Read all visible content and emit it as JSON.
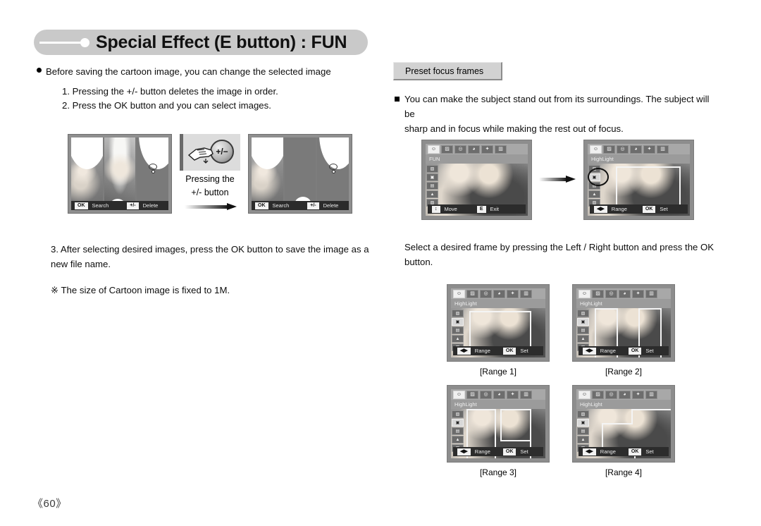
{
  "page": {
    "title": "Special Effect (E button) :  FUN",
    "number": "《60》"
  },
  "left_column": {
    "bullet_1": "Before saving the cartoon image, you can change the selected image",
    "step_1": "1. Pressing the +/- button deletes the image in order.",
    "step_2": "2. Press the OK button and you can select images.",
    "step_3": "3. After selecting desired images, press the OK button to save the image as a\n    new file name.",
    "note": "※ The size of Cartoon image is fixed to 1M.",
    "press_caption_line1": "Pressing the",
    "press_caption_line2": "+/- button",
    "pm_button_label": "+/−",
    "filmstrip_left": {
      "key_ok": "OK",
      "label_search": "Search",
      "key_pm": "+/-",
      "label_delete": "Delete"
    },
    "filmstrip_right": {
      "key_ok": "OK",
      "label_search": "Search",
      "key_pm": "+/-",
      "label_delete": "Delete"
    }
  },
  "right_column": {
    "section_tab": "Preset focus frames",
    "bullet_1": "You can make the subject stand out from its surroundings. The subject will be\nsharp and in focus while making the rest out of focus.",
    "instruction": "Select a desired frame by pressing the Left / Right button and press the OK\nbutton.",
    "icons_top_bar": [
      "face-icon",
      "picture-icon",
      "camera-icon",
      "palette-icon",
      "magic-wand-icon",
      "equalizer-icon"
    ],
    "side_icons": [
      "image-icon",
      "highlight-icon",
      "composite-icon",
      "mountain-icon",
      "frame-icon"
    ],
    "cameras": [
      {
        "mode": "FUN",
        "bottom_key_1": "↕",
        "bottom_label_1": "Move",
        "bottom_key_2": "E",
        "bottom_label_2": "Exit"
      },
      {
        "mode": "HighLight",
        "bottom_key_1": "◀▶",
        "bottom_label_1": "Range",
        "bottom_key_2": "OK",
        "bottom_label_2": "Set"
      }
    ],
    "range_examples": [
      {
        "caption": "[Range 1]",
        "mode": "HighLight",
        "bottom_key_1": "◀▶",
        "bottom_label_1": "Range",
        "bottom_key_2": "OK",
        "bottom_label_2": "Set"
      },
      {
        "caption": "[Range 2]",
        "mode": "HighLight",
        "bottom_key_1": "◀▶",
        "bottom_label_1": "Range",
        "bottom_key_2": "OK",
        "bottom_label_2": "Set"
      },
      {
        "caption": "[Range 3]",
        "mode": "HighLight",
        "bottom_key_1": "◀▶",
        "bottom_label_1": "Range",
        "bottom_key_2": "OK",
        "bottom_label_2": "Set"
      },
      {
        "caption": "[Range 4]",
        "mode": "HighLight",
        "bottom_key_1": "◀▶",
        "bottom_label_1": "Range",
        "bottom_key_2": "OK",
        "bottom_label_2": "Set"
      }
    ]
  },
  "colors": {
    "banner_bg": "#c9c9c9",
    "tab_bg": "#d2d2d2",
    "lcd_bg": "#8d8d8d",
    "bar_bg": "#2c2c2c"
  }
}
